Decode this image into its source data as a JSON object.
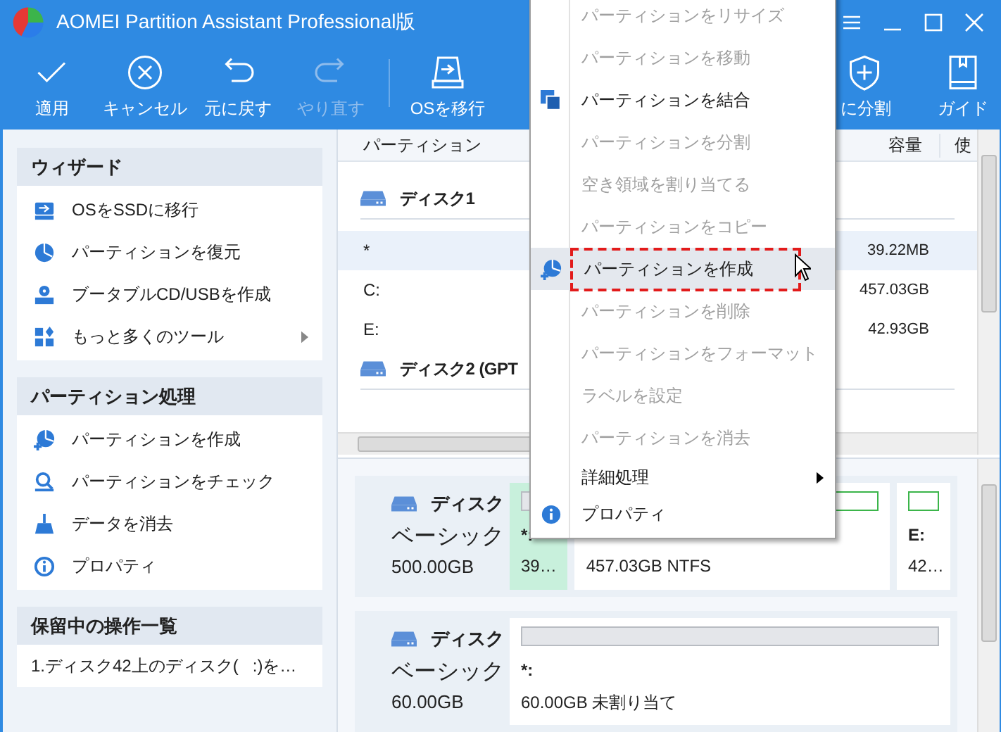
{
  "window": {
    "title": "AOMEI Partition Assistant Professional版"
  },
  "toolbar": [
    {
      "label": "適用",
      "kind": "apply",
      "disabled": false
    },
    {
      "label": "キャンセル",
      "kind": "cancel",
      "disabled": false
    },
    {
      "label": "元に戻す",
      "kind": "undo",
      "disabled": false
    },
    {
      "label": "やり直す",
      "kind": "redo",
      "disabled": true
    },
    {
      "label": "OSを移行",
      "kind": "migrate",
      "disabled": false
    },
    {
      "label": "に分割",
      "kind": "split",
      "disabled": false
    },
    {
      "label": "ガイド",
      "kind": "guide",
      "disabled": false
    }
  ],
  "sidebar": {
    "sections": [
      {
        "title": "ウィザード",
        "items": [
          {
            "label": "OSをSSDに移行",
            "kind": "migrate"
          },
          {
            "label": "パーティションを復元",
            "kind": "recover"
          },
          {
            "label": "ブータブルCD/USBを作成",
            "kind": "bootable"
          },
          {
            "label": "もっと多くのツール",
            "kind": "tools",
            "submenu": true
          }
        ]
      },
      {
        "title": "パーティション処理",
        "items": [
          {
            "label": "パーティションを作成",
            "kind": "create"
          },
          {
            "label": "パーティションをチェック",
            "kind": "check"
          },
          {
            "label": "データを消去",
            "kind": "wipe"
          },
          {
            "label": "プロパティ",
            "kind": "info"
          }
        ]
      },
      {
        "title": "保留中の操作一覧",
        "items": [
          {
            "label": "1.ディスク42上のディスク(   :)を…",
            "kind": "pending"
          }
        ]
      }
    ]
  },
  "table": {
    "columns": [
      "パーティション",
      "容量",
      "使"
    ],
    "groups": [
      {
        "disk": "ディスク1",
        "rows": [
          {
            "partition": "*",
            "capacity": "39.22MB",
            "selected": true
          },
          {
            "partition": "C:",
            "capacity": "457.03GB",
            "selected": false
          },
          {
            "partition": "E:",
            "capacity": "42.93GB",
            "selected": false
          }
        ]
      },
      {
        "disk": "ディスク2 (GPT"
      }
    ]
  },
  "disk_map": [
    {
      "name": "ディスク",
      "type": "ベーシック",
      "size": "500.00GB",
      "partitions": [
        {
          "label": "*:",
          "info": "39…",
          "kind": "unallocated",
          "selected": true
        },
        {
          "info": "457.03GB NTFS",
          "kind": "ntfs",
          "selected": false
        },
        {
          "label": "E:",
          "info": "42…",
          "kind": "ntfs",
          "selected": false
        }
      ]
    },
    {
      "name": "ディスク",
      "type": "ベーシック",
      "size": "60.00GB",
      "partitions": [
        {
          "label": "*:",
          "info": "60.00GB 未割り当て",
          "kind": "unallocated",
          "selected": false
        }
      ]
    }
  ],
  "context_menu": [
    {
      "label": "パーティションをリサイズ",
      "disabled": true,
      "selected": false
    },
    {
      "label": "パーティションを移動",
      "disabled": true,
      "selected": false
    },
    {
      "label": "パーティションを結合",
      "disabled": false,
      "selected": false,
      "kind": "merge"
    },
    {
      "label": "パーティションを分割",
      "disabled": true,
      "selected": false
    },
    {
      "label": "空き領域を割り当てる",
      "disabled": true,
      "selected": false
    },
    {
      "label": "パーティションをコピー",
      "disabled": true,
      "selected": false
    },
    {
      "label": "パーティションを作成",
      "disabled": false,
      "selected": true,
      "kind": "create"
    },
    {
      "label": "パーティションを削除",
      "disabled": true,
      "selected": false
    },
    {
      "label": "パーティションをフォーマット",
      "disabled": true,
      "selected": false
    },
    {
      "label": "ラベルを設定",
      "disabled": true,
      "selected": false
    },
    {
      "label": "パーティションを消去",
      "disabled": true,
      "selected": false
    },
    {
      "label": "詳細処理",
      "disabled": false,
      "selected": false,
      "kind": "submenu"
    },
    {
      "label": "プロパティ",
      "disabled": false,
      "selected": false,
      "kind": "info"
    }
  ]
}
